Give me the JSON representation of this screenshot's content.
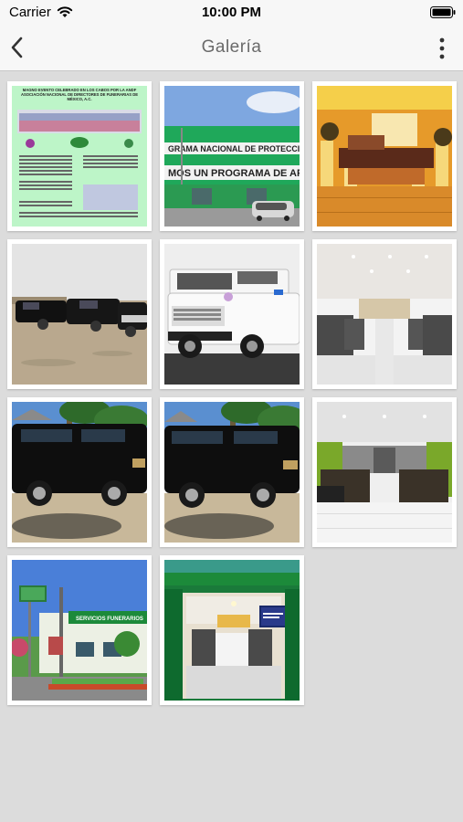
{
  "status_bar": {
    "carrier": "Carrier",
    "time": "10:00 PM"
  },
  "nav": {
    "title": "Galería"
  },
  "gallery": {
    "images": [
      {
        "name": "event-flyer"
      },
      {
        "name": "building-facade"
      },
      {
        "name": "chapel-casket"
      },
      {
        "name": "vehicle-fleet"
      },
      {
        "name": "white-hummer"
      },
      {
        "name": "chapel-seating"
      },
      {
        "name": "black-hummer-1"
      },
      {
        "name": "black-hummer-2"
      },
      {
        "name": "green-chapel"
      },
      {
        "name": "exterior-sign"
      },
      {
        "name": "entrance-view"
      }
    ],
    "flyer_text": "MAGNO EVENTO CELEBRADO EN LOS CABOS POR LA ANDF ASOCIACIÓN NACIONAL DE DIRECTORES DE FUNERARIAS DE MÉXICO, A.C.",
    "building_sign_1": "GRAMA NACIONAL DE PROTECCION F",
    "building_sign_2": "MOS UN PROGRAMA DE APOYO S",
    "exterior_sign": "SERVICIOS FUNERARIOS"
  }
}
